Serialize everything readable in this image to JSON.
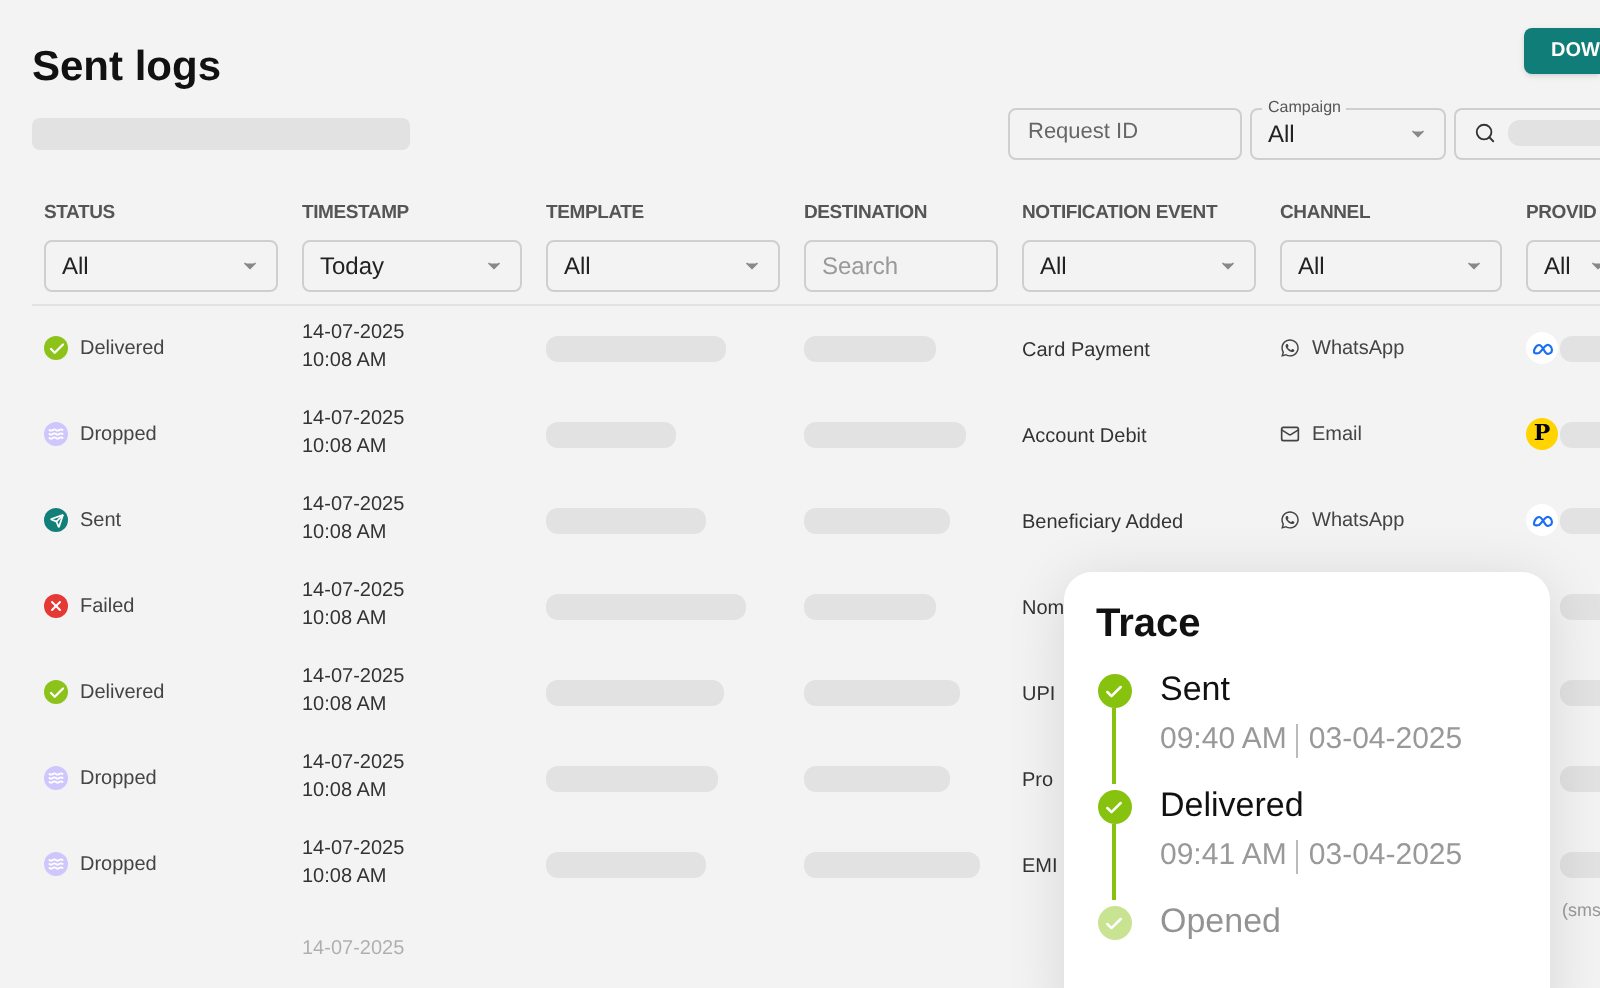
{
  "page": {
    "title": "Sent logs",
    "download_button": "DOW"
  },
  "filters": {
    "request_id": {
      "placeholder": "Request ID"
    },
    "campaign": {
      "label": "Campaign",
      "value": "All"
    }
  },
  "table": {
    "columns": [
      {
        "label": "STATUS",
        "filter": {
          "kind": "select",
          "value": "All"
        }
      },
      {
        "label": "TIMESTAMP",
        "filter": {
          "kind": "select",
          "value": "Today"
        }
      },
      {
        "label": "TEMPLATE",
        "filter": {
          "kind": "select",
          "value": "All"
        }
      },
      {
        "label": "DESTINATION",
        "filter": {
          "kind": "search",
          "placeholder": "Search"
        }
      },
      {
        "label": "NOTIFICATION EVENT",
        "filter": {
          "kind": "select",
          "value": "All"
        }
      },
      {
        "label": "CHANNEL",
        "filter": {
          "kind": "select",
          "value": "All"
        }
      },
      {
        "label": "PROVID",
        "filter": {
          "kind": "select",
          "value": "All"
        }
      }
    ],
    "rows": [
      {
        "status": {
          "kind": "delivered",
          "label": "Delivered"
        },
        "date": "14-07-2025",
        "time": "10:08 AM",
        "event": "Card Payment",
        "channel": {
          "kind": "whatsapp",
          "label": "WhatsApp"
        },
        "provider": {
          "kind": "meta"
        }
      },
      {
        "status": {
          "kind": "dropped",
          "label": "Dropped"
        },
        "date": "14-07-2025",
        "time": "10:08 AM",
        "event": "Account Debit",
        "channel": {
          "kind": "email",
          "label": "Email"
        },
        "provider": {
          "kind": "p",
          "letter": "P"
        }
      },
      {
        "status": {
          "kind": "sent",
          "label": "Sent"
        },
        "date": "14-07-2025",
        "time": "10:08 AM",
        "event": "Beneficiary Added",
        "channel": {
          "kind": "whatsapp",
          "label": "WhatsApp"
        },
        "provider": {
          "kind": "meta"
        }
      },
      {
        "status": {
          "kind": "failed",
          "label": "Failed"
        },
        "date": "14-07-2025",
        "time": "10:08 AM",
        "event": "Nom",
        "provider": {
          "kind": "none"
        }
      },
      {
        "status": {
          "kind": "delivered",
          "label": "Delivered"
        },
        "date": "14-07-2025",
        "time": "10:08 AM",
        "event": "UPI",
        "provider": {
          "kind": "none"
        }
      },
      {
        "status": {
          "kind": "dropped",
          "label": "Dropped"
        },
        "date": "14-07-2025",
        "time": "10:08 AM",
        "event": "Pro",
        "provider": {
          "kind": "none"
        }
      },
      {
        "status": {
          "kind": "dropped",
          "label": "Dropped"
        },
        "date": "14-07-2025",
        "time": "10:08 AM",
        "event": "EMI",
        "provider": {
          "kind": "none",
          "note": "(sms"
        }
      },
      {
        "date": "14-07-2025"
      }
    ]
  },
  "trace": {
    "title": "Trace",
    "steps": [
      {
        "name": "Sent",
        "time": "09:40 AM",
        "date": "03-04-2025"
      },
      {
        "name": "Delivered",
        "time": "09:41 AM",
        "date": "03-04-2025"
      },
      {
        "name": "Opened"
      }
    ]
  }
}
